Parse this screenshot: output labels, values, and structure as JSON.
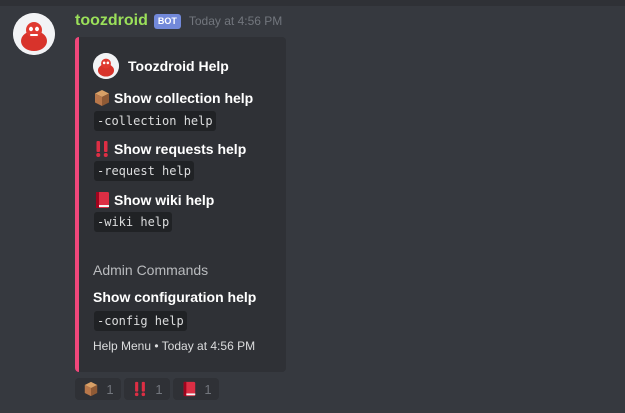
{
  "message": {
    "username": "toozdroid",
    "bot_tag": "BOT",
    "timestamp": "Today at 4:56 PM"
  },
  "embed": {
    "accent_color": "#f0477b",
    "author": "Toozdroid Help",
    "fields": [
      {
        "icon": "package-icon",
        "name": "Show collection help",
        "value": "-collection help"
      },
      {
        "icon": "double-exclamation-icon",
        "name": "Show requests help",
        "value": "-request help"
      },
      {
        "icon": "red-book-icon",
        "name": "Show wiki help",
        "value": "-wiki help"
      }
    ],
    "section_title": "Admin Commands",
    "admin_field": {
      "name": "Show configuration help",
      "value": "-config help"
    },
    "footer": "Help Menu • Today at 4:56 PM"
  },
  "reactions": [
    {
      "icon": "package-icon",
      "count": "1"
    },
    {
      "icon": "double-exclamation-icon",
      "count": "1"
    },
    {
      "icon": "red-book-icon",
      "count": "1"
    }
  ]
}
